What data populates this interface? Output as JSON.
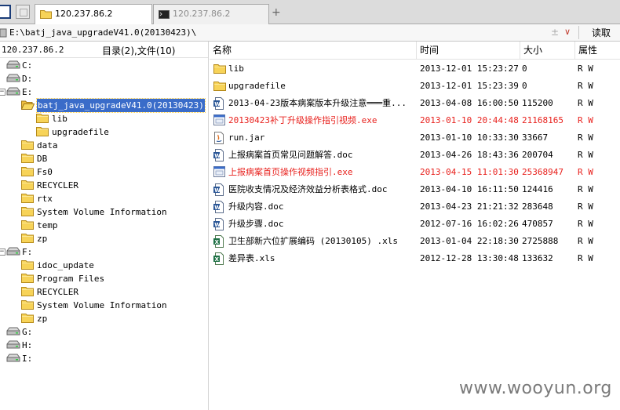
{
  "tabs": [
    {
      "label": "120.237.86.2",
      "icon": "folder-icon",
      "active": true
    },
    {
      "label": "120.237.86.2",
      "icon": "terminal-icon",
      "active": false
    }
  ],
  "address": {
    "path": "E:\\batj_java_upgradeV41.0(20130423)\\",
    "up_glyph": "±",
    "dropdown_glyph": "∨",
    "read_label": "读取"
  },
  "left": {
    "host": "120.237.86.2",
    "summary": "目录(2),文件(10)",
    "tree": [
      {
        "label": "C:",
        "icon": "drive-icon",
        "expander": ""
      },
      {
        "label": "D:",
        "icon": "drive-icon",
        "expander": ""
      },
      {
        "label": "E:",
        "icon": "drive-icon",
        "expander": "−"
      },
      {
        "label": "batj_java_upgradeV41.0(20130423)",
        "icon": "folder-open-icon",
        "expander": "−",
        "selected": true
      },
      {
        "label": "lib",
        "icon": "folder-icon",
        "expander": ""
      },
      {
        "label": "upgradefile",
        "icon": "folder-icon",
        "expander": ""
      },
      {
        "label": "data",
        "icon": "folder-icon",
        "expander": ""
      },
      {
        "label": "DB",
        "icon": "folder-icon",
        "expander": ""
      },
      {
        "label": "Fs0",
        "icon": "folder-icon",
        "expander": "+"
      },
      {
        "label": "RECYCLER",
        "icon": "folder-icon",
        "expander": "+"
      },
      {
        "label": "rtx",
        "icon": "folder-icon",
        "expander": "+"
      },
      {
        "label": "System Volume Information",
        "icon": "folder-icon",
        "expander": ""
      },
      {
        "label": "temp",
        "icon": "folder-icon",
        "expander": ""
      },
      {
        "label": "zp",
        "icon": "folder-icon",
        "expander": "+"
      },
      {
        "label": "F:",
        "icon": "drive-icon",
        "expander": "−"
      },
      {
        "label": "idoc_update",
        "icon": "folder-icon",
        "expander": ""
      },
      {
        "label": "Program Files",
        "icon": "folder-icon",
        "expander": "+"
      },
      {
        "label": "RECYCLER",
        "icon": "folder-icon",
        "expander": "+"
      },
      {
        "label": "System Volume Information",
        "icon": "folder-icon",
        "expander": ""
      },
      {
        "label": "zp",
        "icon": "folder-icon",
        "expander": "+"
      },
      {
        "label": "G:",
        "icon": "drive-icon",
        "expander": ""
      },
      {
        "label": "H:",
        "icon": "drive-icon",
        "expander": ""
      },
      {
        "label": "I:",
        "icon": "drive-icon",
        "expander": ""
      }
    ]
  },
  "columns": {
    "name": "名称",
    "time": "时间",
    "size": "大小",
    "attr": "属性"
  },
  "files": [
    {
      "name": "lib",
      "time": "2013-12-01 15:23:27",
      "size": "0",
      "attr": "R W",
      "icon": "folder-icon",
      "highlight": false
    },
    {
      "name": "upgradefile",
      "time": "2013-12-01 15:23:39",
      "size": "0",
      "attr": "R W",
      "icon": "folder-icon",
      "highlight": false
    },
    {
      "name": "2013-04-23版本病案版本升级注意═══重...",
      "time": "2013-04-08 16:00:50",
      "size": "115200",
      "attr": "R W",
      "icon": "word-doc-icon",
      "highlight": false
    },
    {
      "name": "20130423补丁升级操作指引视频.exe",
      "time": "2013-01-10 20:44:48",
      "size": "21168165",
      "attr": "R W",
      "icon": "exe-icon",
      "highlight": true
    },
    {
      "name": "run.jar",
      "time": "2013-01-10 10:33:30",
      "size": "33667",
      "attr": "R W",
      "icon": "jar-icon",
      "highlight": false
    },
    {
      "name": "上报病案首页常见问题解答.doc",
      "time": "2013-04-26 18:43:36",
      "size": "200704",
      "attr": "R W",
      "icon": "word-doc-icon",
      "highlight": false
    },
    {
      "name": "上报病案首页操作视频指引.exe",
      "time": "2013-04-15 11:01:30",
      "size": "25368947",
      "attr": "R W",
      "icon": "exe-icon",
      "highlight": true
    },
    {
      "name": "医院收支情况及经济效益分析表格式.doc",
      "time": "2013-04-10 16:11:50",
      "size": "124416",
      "attr": "R W",
      "icon": "word-doc-icon",
      "highlight": false
    },
    {
      "name": "升级内容.doc",
      "time": "2013-04-23 21:21:32",
      "size": "283648",
      "attr": "R W",
      "icon": "word-doc-icon",
      "highlight": false
    },
    {
      "name": "升级步骤.doc",
      "time": "2012-07-16 16:02:26",
      "size": "470857",
      "attr": "R W",
      "icon": "word-doc-icon",
      "highlight": false
    },
    {
      "name": "卫生部新六位扩展编码 (20130105) .xls",
      "time": "2013-01-04 22:18:30",
      "size": "2725888",
      "attr": "R W",
      "icon": "excel-icon",
      "highlight": false
    },
    {
      "name": "差异表.xls",
      "time": "2012-12-28 13:30:48",
      "size": "133632",
      "attr": "R W",
      "icon": "excel-icon",
      "highlight": false
    }
  ],
  "watermark": "www.wooyun.org",
  "colors": {
    "highlight_text": "#e8211d",
    "selection_bg": "#3a6cc9",
    "folder": "#f2c94c"
  }
}
